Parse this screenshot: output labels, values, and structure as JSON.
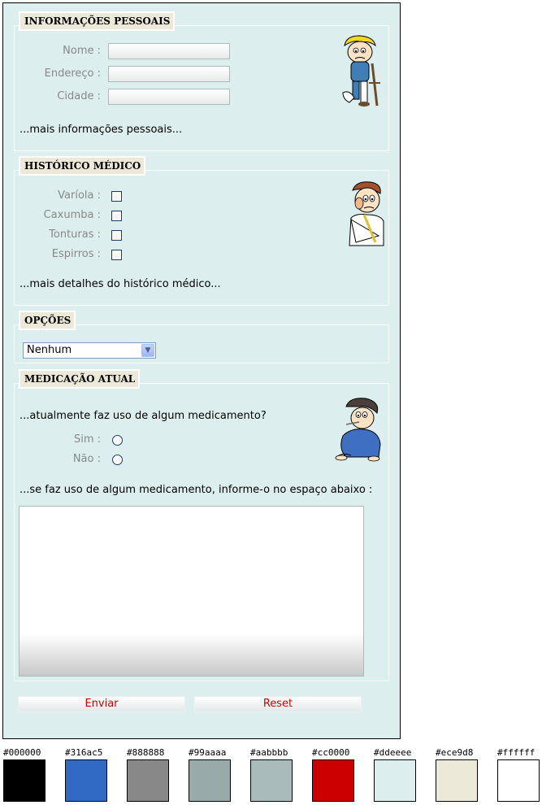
{
  "sections": {
    "personal": {
      "legend": "INFORMAÇÕES PESSOAIS",
      "fields": [
        {
          "label": "Nome :",
          "value": ""
        },
        {
          "label": "Endereço :",
          "value": ""
        },
        {
          "label": "Cidade :",
          "value": ""
        }
      ],
      "more_text": "...mais informações pessoais..."
    },
    "medical_history": {
      "legend": "HISTÓRICO MÉDICO",
      "checks": [
        {
          "label": "Varíola :",
          "checked": false
        },
        {
          "label": "Caxumba :",
          "checked": false
        },
        {
          "label": "Tonturas :",
          "checked": false
        },
        {
          "label": "Espirros :",
          "checked": false
        }
      ],
      "more_text": "...mais detalhes do histórico médico..."
    },
    "options": {
      "legend": "OPÇÕES",
      "select_value": "Nenhum"
    },
    "medication": {
      "legend": "MEDICAÇÃO ATUAL",
      "question": "...atualmente faz uso de algum medicamento?",
      "radios": [
        {
          "label": "Sim :",
          "selected": false
        },
        {
          "label": "Não :",
          "selected": false
        }
      ],
      "instruction": "...se faz uso de algum medicamento, informe-o no espaço abaixo :",
      "textarea_value": ""
    }
  },
  "buttons": {
    "submit": "Enviar",
    "reset": "Reset"
  },
  "illustrations": [
    "injured-boy-crutches",
    "man-with-arm-sling",
    "sick-child-thermometer"
  ],
  "palette": [
    {
      "label": "#000000",
      "color": "#000000"
    },
    {
      "label": "#316ac5",
      "color": "#316ac5"
    },
    {
      "label": "#888888",
      "color": "#888888"
    },
    {
      "label": "#99aaaa",
      "color": "#99aaaa"
    },
    {
      "label": "#aabbbb",
      "color": "#aabbbb"
    },
    {
      "label": "#cc0000",
      "color": "#cc0000"
    },
    {
      "label": "#ddeeee",
      "color": "#ddeeee"
    },
    {
      "label": "#ece9d8",
      "color": "#ece9d8"
    },
    {
      "label": "#ffffff",
      "color": "#ffffff"
    }
  ]
}
